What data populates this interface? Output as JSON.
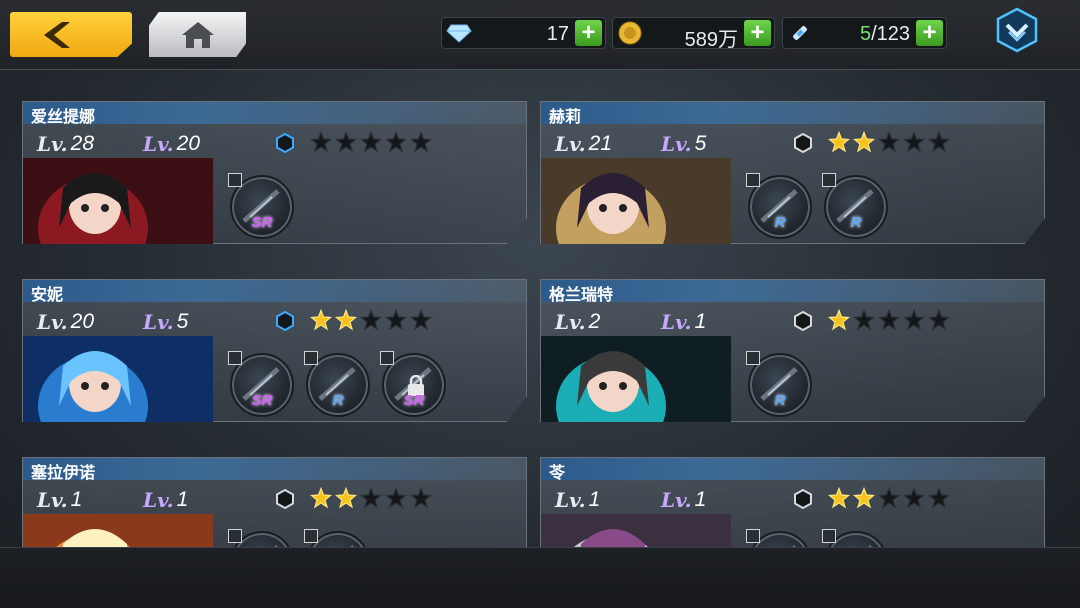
{
  "resources": {
    "gems": "17",
    "gold": "589万",
    "stamina_current": "5",
    "stamina_max": "/123"
  },
  "cards": [
    {
      "name": "爱丝提娜",
      "lv_blue": "28",
      "lv_purple": "20",
      "stars": 0,
      "hex_active": true,
      "weapons": [
        {
          "rarity": "SR",
          "locked": false
        }
      ]
    },
    {
      "name": "赫莉",
      "lv_blue": "21",
      "lv_purple": "5",
      "stars": 2,
      "hex_active": false,
      "weapons": [
        {
          "rarity": "R",
          "locked": false
        },
        {
          "rarity": "R",
          "locked": false
        }
      ]
    },
    {
      "name": "安妮",
      "lv_blue": "20",
      "lv_purple": "5",
      "stars": 2,
      "hex_active": true,
      "weapons": [
        {
          "rarity": "SR",
          "locked": false
        },
        {
          "rarity": "R",
          "locked": false
        },
        {
          "rarity": "SR",
          "locked": true
        }
      ]
    },
    {
      "name": "格兰瑞特",
      "lv_blue": "2",
      "lv_purple": "1",
      "stars": 1,
      "hex_active": false,
      "weapons": [
        {
          "rarity": "R",
          "locked": false
        }
      ]
    },
    {
      "name": "塞拉伊诺",
      "lv_blue": "1",
      "lv_purple": "1",
      "stars": 2,
      "hex_active": false,
      "weapons": [
        {
          "rarity": "",
          "locked": false
        },
        {
          "rarity": "",
          "locked": false
        }
      ]
    },
    {
      "name": "苓",
      "lv_blue": "1",
      "lv_purple": "1",
      "stars": 2,
      "hex_active": false,
      "weapons": [
        {
          "rarity": "",
          "locked": false
        },
        {
          "rarity": "",
          "locked": false
        }
      ]
    }
  ],
  "labels": {
    "lv_prefix": "Lv."
  },
  "colors": {
    "accent_gold": "#f0a812",
    "plus_green": "#3a9a1f",
    "sr_purple": "#d25cff",
    "r_blue": "#5aa8ff",
    "hex_blue": "#3da9ff"
  },
  "icons": {
    "back": "chevron-left-icon",
    "home": "home-icon",
    "gem": "diamond-icon",
    "gold": "coin-icon",
    "stamina": "syringe-icon",
    "menu": "chevron-down-hex-icon"
  }
}
